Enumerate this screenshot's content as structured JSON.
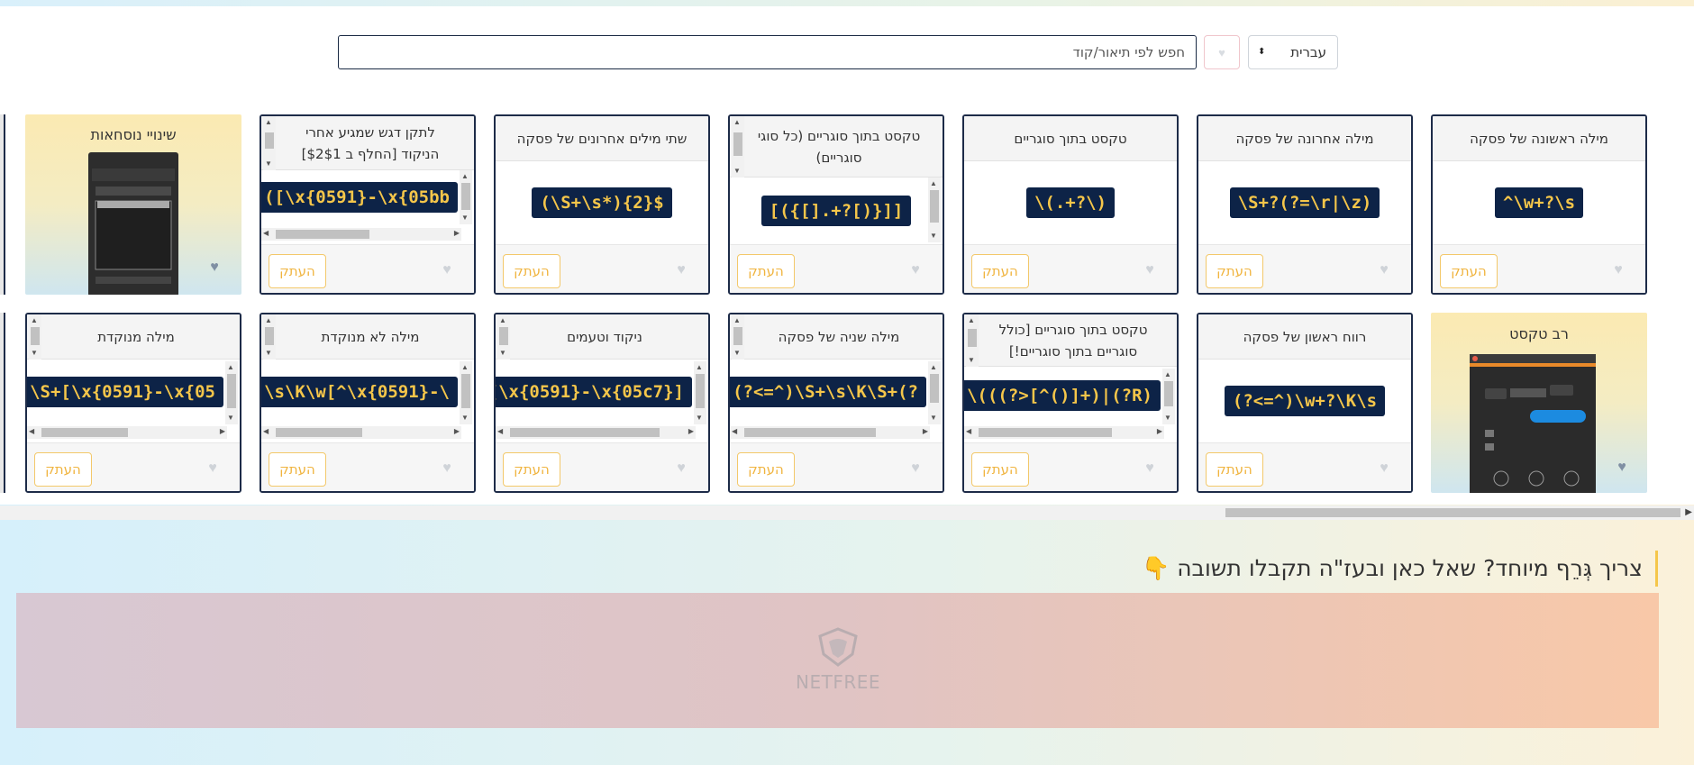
{
  "search": {
    "placeholder": "חפש לפי תיאור/קוד"
  },
  "language_select": {
    "value": "עברית"
  },
  "copy_label": "העתק",
  "row1": [
    {
      "title": "מילה ראשונה של פסקה",
      "code": "^\\w+?\\s"
    },
    {
      "title": "מילה אחרונה של פסקה",
      "code": "\\S+?(?=\\r|\\z)"
    },
    {
      "title": "טקסט בתוך סוגריים",
      "code": "\\(.+?\\)"
    },
    {
      "title": "טקסט בתוך סוגריים (כל סוגי סוגריים)",
      "code": "[({[].+?[)}]]"
    },
    {
      "title": "שתי מילים אחרונים של פסקה",
      "code": "(\\S+\\s*){2}$"
    },
    {
      "title": "לתקן דגש שמגיע אחרי הניקוד [החלף ב $2$1]",
      "code": "([\\x{0591}-\\x{05bb"
    }
  ],
  "row1_image_card": {
    "title": "שינויי נוסחאות"
  },
  "row2_image_card": {
    "title": "רב טקסט"
  },
  "row2": [
    {
      "title": "רווח ראשון של פסקה",
      "code": "(?<=^)\\w+?\\K\\s"
    },
    {
      "title": "טקסט בתוך סוגריים [כולל סוגריים בתוך סוגריים!]",
      "code": "\\(((?>[^()]+)|(?R)"
    },
    {
      "title": "מילה שניה של פסקה",
      "code": "(?<=^)\\S+\\s\\K\\S+(?"
    },
    {
      "title": "ניקוד וטעמים",
      "code": "[\\x{0591}-\\x{05c7}]"
    },
    {
      "title": "מילה לא מנוקדת",
      "code": "\\s\\K\\w[^\\x{0591}-\\"
    },
    {
      "title": "מילה מנוקדת",
      "code": "\\S+[\\x{0591}-\\x{05"
    }
  ],
  "help": {
    "question": "צריך גְּרֵף מיוחד? שאל כאן ובעז\"ה תקבלו תשובה",
    "emoji": "👇"
  },
  "banner": {
    "logo_text": "NETFREE"
  },
  "colors": {
    "navy": "#0d2347",
    "code_text": "#f5c64a",
    "accent": "#f0b43f"
  }
}
